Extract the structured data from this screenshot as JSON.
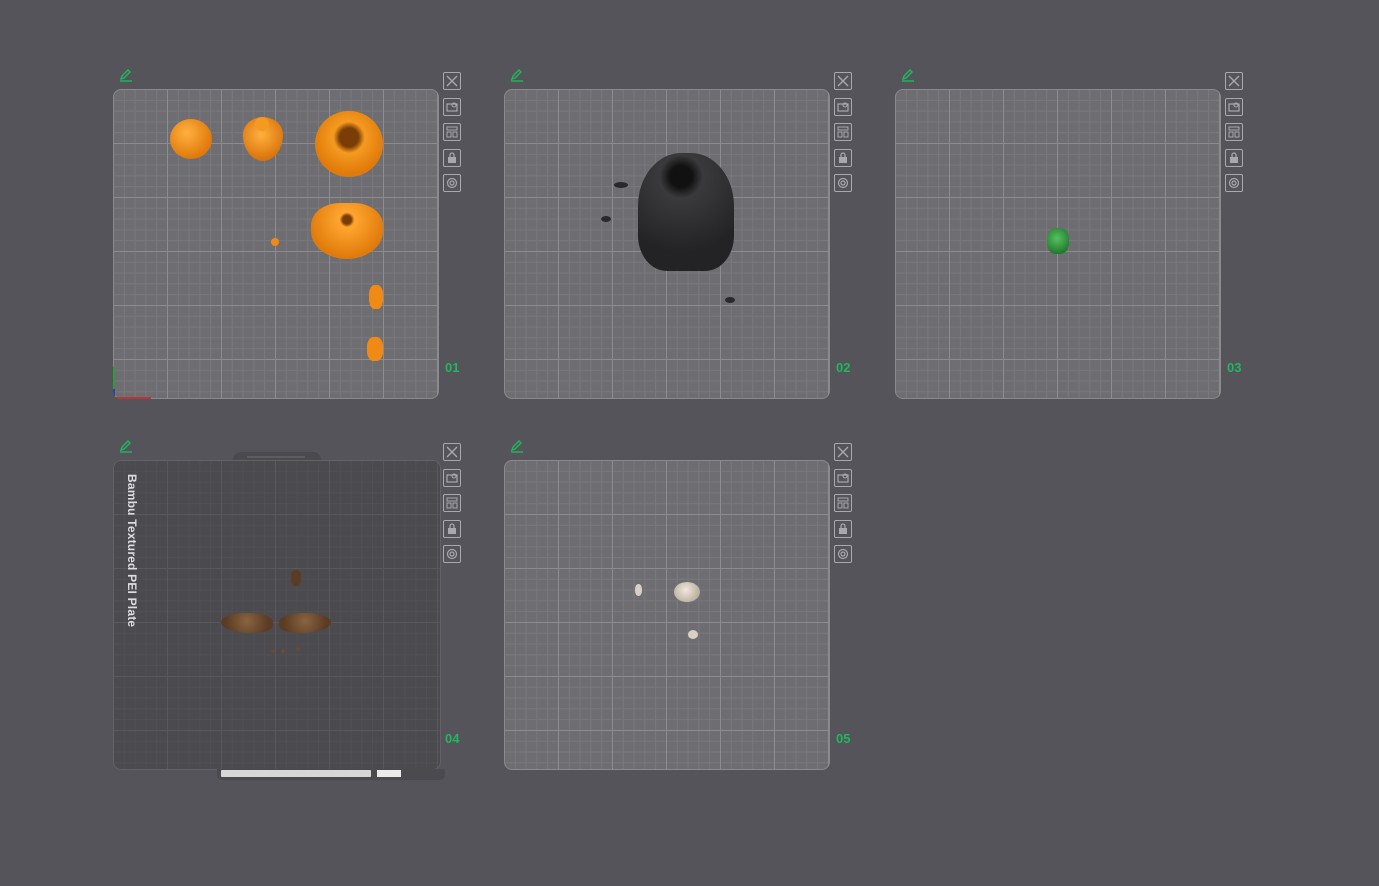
{
  "plates": [
    {
      "number": "01",
      "textured": false,
      "bed_label": ""
    },
    {
      "number": "02",
      "textured": false,
      "bed_label": ""
    },
    {
      "number": "03",
      "textured": false,
      "bed_label": ""
    },
    {
      "number": "04",
      "textured": true,
      "bed_label": "Bambu Textured PEI Plate"
    },
    {
      "number": "05",
      "textured": false,
      "bed_label": ""
    }
  ],
  "toolbar_icons": [
    "close-icon",
    "auto-orient-icon",
    "arrange-icon",
    "lock-icon",
    "settings-icon"
  ],
  "colors": {
    "background": "#55545a",
    "accent_green": "#1fb85c",
    "orange_filament": "#f08a14",
    "black_filament": "#2a2a2c",
    "green_filament": "#2f8c3a",
    "brown_filament": "#6b4a2f",
    "bone_filament": "#d8d0c4"
  }
}
